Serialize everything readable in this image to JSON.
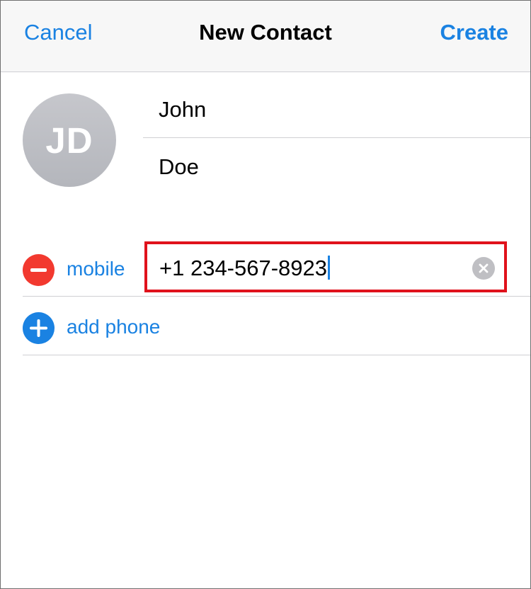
{
  "navbar": {
    "cancel_label": "Cancel",
    "title": "New Contact",
    "create_label": "Create"
  },
  "avatar": {
    "initials": "JD"
  },
  "name": {
    "first": "John",
    "last": "Doe"
  },
  "phone": {
    "label": "mobile",
    "value": "+1 234-567-8923",
    "remove_icon": "minus-circle-icon",
    "clear_icon": "clear-circle-icon"
  },
  "add_phone": {
    "label": "add phone",
    "icon": "plus-circle-icon"
  },
  "colors": {
    "accent": "#1a82e2",
    "destructive": "#f2392f",
    "highlight_border": "#e0121c",
    "avatar_gray": "#bdbec3"
  }
}
